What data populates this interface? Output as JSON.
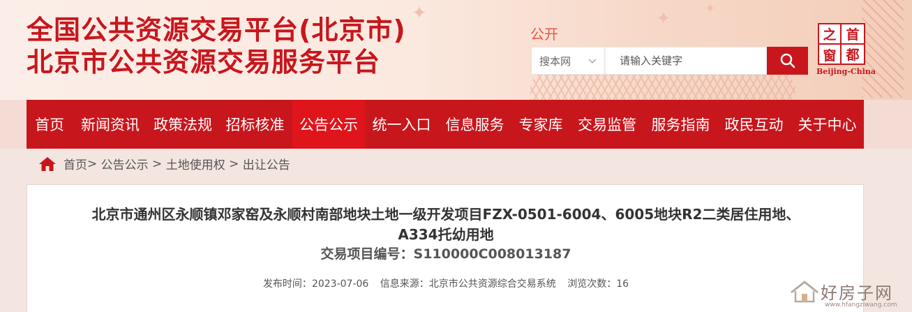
{
  "header": {
    "title_line1": "全国公共资源交易平台(北京市)",
    "title_line2": "北京市公共资源交易服务平台",
    "gongkai": "公开"
  },
  "search": {
    "scope_selected": "搜本网",
    "placeholder": "请输入关键字"
  },
  "logo": {
    "chars": [
      "首",
      "都",
      "之",
      "窗"
    ],
    "subtitle": "Beijing-China"
  },
  "nav": {
    "items": [
      {
        "label": "首页",
        "active": false
      },
      {
        "label": "新闻资讯",
        "active": false
      },
      {
        "label": "政策法规",
        "active": false
      },
      {
        "label": "招标核准",
        "active": false
      },
      {
        "label": "公告公示",
        "active": true
      },
      {
        "label": "统一入口",
        "active": false
      },
      {
        "label": "信息服务",
        "active": false
      },
      {
        "label": "专家库",
        "active": false
      },
      {
        "label": "交易监管",
        "active": false
      },
      {
        "label": "服务指南",
        "active": false
      },
      {
        "label": "政民互动",
        "active": false
      },
      {
        "label": "关于中心",
        "active": false
      }
    ]
  },
  "breadcrumb": {
    "items": [
      "首页",
      "公告公示",
      "土地使用权",
      "出让公告"
    ]
  },
  "document": {
    "title_line1": "北京市通州区永顺镇邓家窑及永顺村南部地块土地一级开发项目FZX-0501-6004、6005地块R2二类居住用地、",
    "title_line2": "A334托幼用地",
    "code_label": "交易项目编号：",
    "code_value": "S110000C008013187",
    "publish_label": "发布时间：",
    "publish_value": "2023-07-06",
    "source_label": "信息来源：",
    "source_value": "北京市公共资源综合交易系统",
    "views_label": "浏览次数：",
    "views_value": "16"
  },
  "watermark": {
    "text": "好房子网",
    "url": "www.hfangziwang.com"
  },
  "colors": {
    "brand_red": "#c8161d",
    "active_red": "#e0141b"
  }
}
